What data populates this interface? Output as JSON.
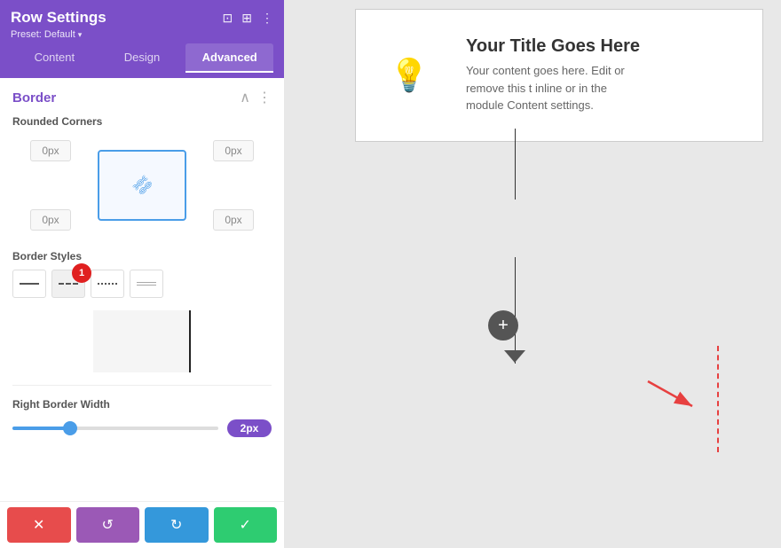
{
  "panel": {
    "title": "Row Settings",
    "preset_label": "Preset: Default",
    "preset_arrow": "▾",
    "tabs": [
      {
        "id": "content",
        "label": "Content"
      },
      {
        "id": "design",
        "label": "Design"
      },
      {
        "id": "advanced",
        "label": "Advanced"
      }
    ],
    "active_tab": "advanced",
    "border_section": {
      "title": "Border",
      "collapse_icon": "^",
      "menu_icon": "⋮",
      "rounded_corners_label": "Rounded Corners",
      "corner_tl": "0px",
      "corner_tr": "0px",
      "corner_bl": "0px",
      "corner_br": "0px",
      "link_icon": "🔗",
      "border_styles_label": "Border Styles",
      "border_styles": [
        {
          "id": "solid",
          "label": "solid"
        },
        {
          "id": "dashed",
          "label": "dashed",
          "badge": "1"
        },
        {
          "id": "dotted",
          "label": "dotted"
        },
        {
          "id": "double",
          "label": "double"
        }
      ],
      "right_border_width_label": "Right Border Width",
      "slider_value": "2px"
    }
  },
  "bottom_bar": {
    "cancel_icon": "✕",
    "reset_icon": "↺",
    "redo_icon": "↻",
    "save_icon": "✓"
  },
  "canvas": {
    "content_title": "Your Title Goes Here",
    "content_body": "Your content goes here. Edit or remove this t inline or in the module Content settings.",
    "add_label": "+",
    "bulb_icon": "💡"
  }
}
